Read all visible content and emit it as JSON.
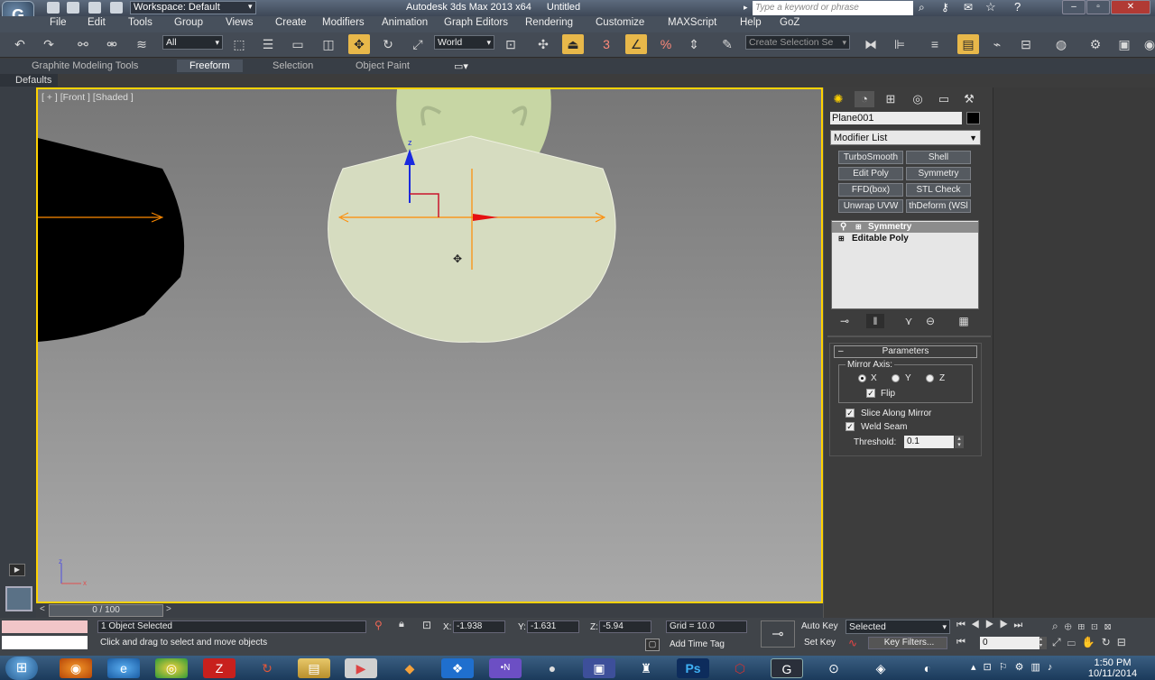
{
  "app": {
    "title": "Autodesk 3ds Max  2013 x64",
    "document": "Untitled",
    "workspace": "Workspace: Default",
    "search_placeholder": "Type a keyword or phrase"
  },
  "menu": [
    "File",
    "Edit",
    "Tools",
    "Group",
    "Views",
    "Create",
    "Modifiers",
    "Animation",
    "Graph Editors",
    "Rendering",
    "Customize",
    "MAXScript",
    "Help",
    "GoZ"
  ],
  "toolbar": {
    "selection_filter": "All",
    "coord_system": "World",
    "named_selection": "Create Selection Se",
    "snap_label": "3",
    "angle_snap_label": "%"
  },
  "ribbon": {
    "tabs": [
      "Graphite Modeling Tools",
      "Freeform",
      "Selection",
      "Object Paint"
    ],
    "active": "Freeform",
    "defaults": "Defaults"
  },
  "viewport": {
    "label": "[ + ] [Front ] [Shaded ]",
    "gizmo_z": "z",
    "axis_x": "x",
    "axis_z": "z"
  },
  "command_panel": {
    "object_name": "Plane001",
    "modifier_list": "Modifier List",
    "modifier_buttons": [
      "TurboSmooth",
      "Shell",
      "Edit Poly",
      "Symmetry",
      "FFD(box)",
      "STL Check",
      "Unwrap UVW",
      "thDeform (WSl"
    ],
    "stack": [
      "Symmetry",
      "Editable Poly"
    ],
    "parameters": {
      "title": "Parameters",
      "mirror_axis_label": "Mirror Axis:",
      "axes": [
        "X",
        "Y",
        "Z"
      ],
      "selected_axis": "X",
      "flip_label": "Flip",
      "slice_label": "Slice Along Mirror",
      "weld_label": "Weld Seam",
      "threshold_label": "Threshold:",
      "threshold_value": "0.1"
    }
  },
  "timeline": {
    "position": "0 / 100"
  },
  "status": {
    "selected_text": "1 Object Selected",
    "prompt": "Click and drag to select and move objects",
    "x_label": "X:",
    "x": "-1.938",
    "y_label": "Y:",
    "y": "-1.631",
    "z_label": "Z:",
    "z": "-5.94",
    "grid": "Grid = 10.0",
    "add_time_tag": "Add Time Tag",
    "auto_key": "Auto Key",
    "set_key": "Set Key",
    "key_mode": "Selected",
    "key_filters": "Key Filters...",
    "frame": "0"
  },
  "taskbar": {
    "time": "1:50 PM",
    "date": "10/11/2014"
  },
  "colors": {
    "accent": "#ffd200",
    "active_tool": "#e8b84a"
  }
}
